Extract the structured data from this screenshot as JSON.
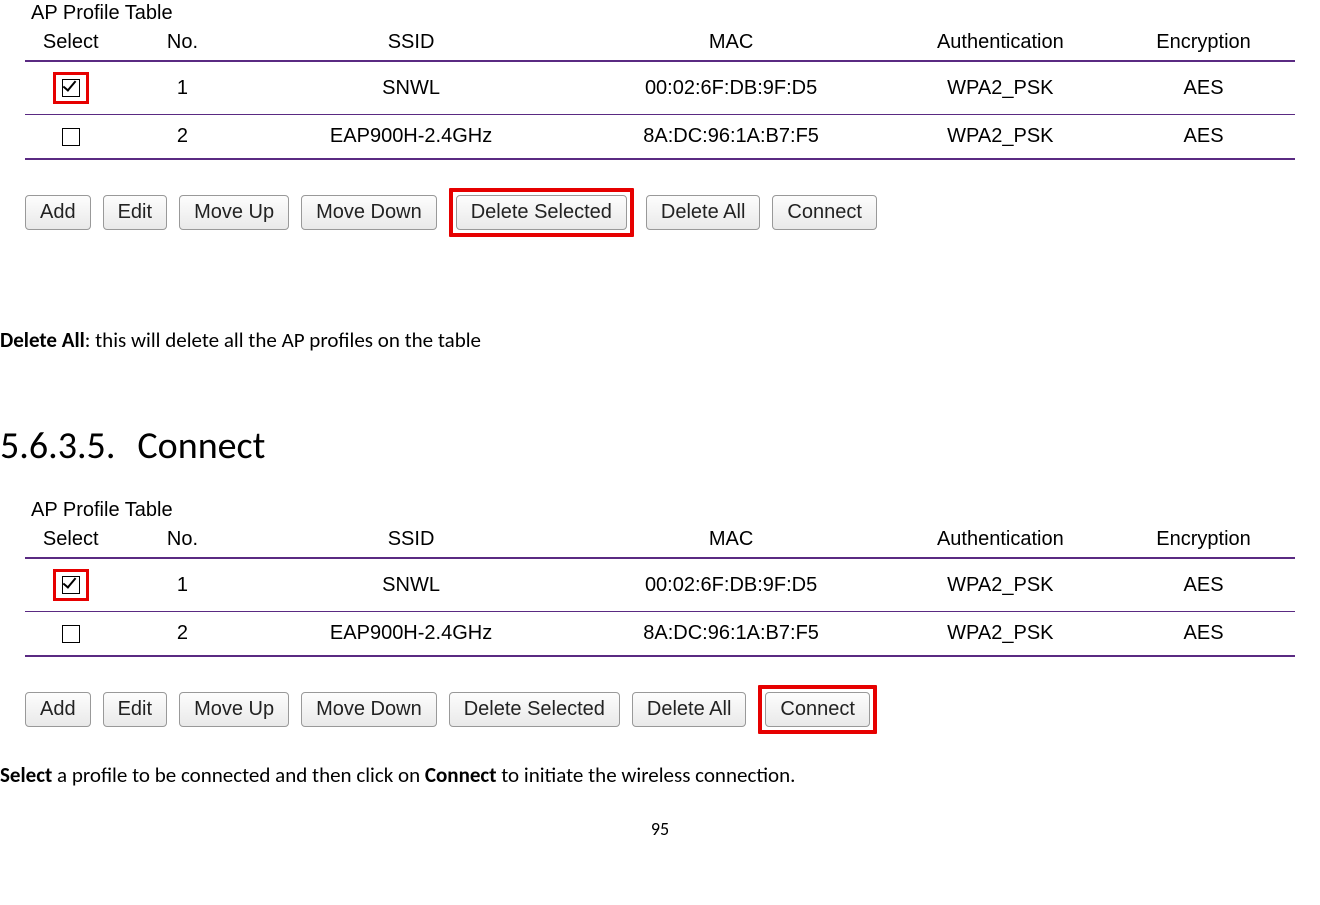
{
  "table_title": "AP Profile Table",
  "headers": {
    "select": "Select",
    "no": "No.",
    "ssid": "SSID",
    "mac": "MAC",
    "auth": "Authentication",
    "enc": "Encryption"
  },
  "rows": [
    {
      "no": "1",
      "ssid": "SNWL",
      "mac": "00:02:6F:DB:9F:D5",
      "auth": "WPA2_PSK",
      "enc": "AES"
    },
    {
      "no": "2",
      "ssid": "EAP900H-2.4GHz",
      "mac": "8A:DC:96:1A:B7:F5",
      "auth": "WPA2_PSK",
      "enc": "AES"
    }
  ],
  "buttons": {
    "add": "Add",
    "edit": "Edit",
    "move_up": "Move Up",
    "move_down": "Move Down",
    "delete_selected": "Delete Selected",
    "delete_all": "Delete All",
    "connect": "Connect"
  },
  "para1_bold": "Delete All",
  "para1_rest": ": this will delete all the AP profiles on the table",
  "section_number": "5.6.3.5.",
  "section_title": "Connect",
  "para2_bold1": "Select",
  "para2_mid": " a profile to be connected and then click on ",
  "para2_bold2": "Connect",
  "para2_rest": " to initiate the wireless connection.",
  "page_number": "95"
}
